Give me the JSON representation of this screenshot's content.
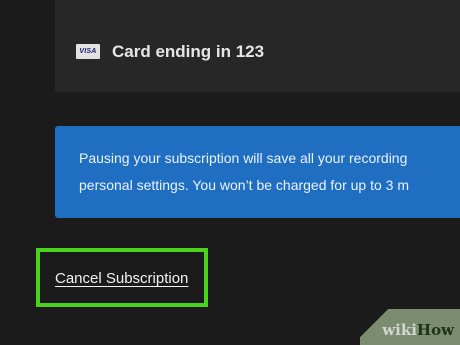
{
  "payment": {
    "card_brand": "VISA",
    "card_label": "Card ending in 123"
  },
  "pause_notice": {
    "line1": "Pausing your subscription will save all your recording",
    "line2": "personal settings. You won’t be charged for up to 3 m"
  },
  "actions": {
    "cancel_label": "Cancel Subscription"
  },
  "watermark": {
    "part1": "wiki",
    "part2": "How"
  },
  "colors": {
    "background": "#1b1b1b",
    "panel": "#272727",
    "notice_blue": "#1f6ec2",
    "highlight_green": "#4ad31c"
  },
  "icons": {
    "card_brand_icon": "visa-card-icon"
  }
}
